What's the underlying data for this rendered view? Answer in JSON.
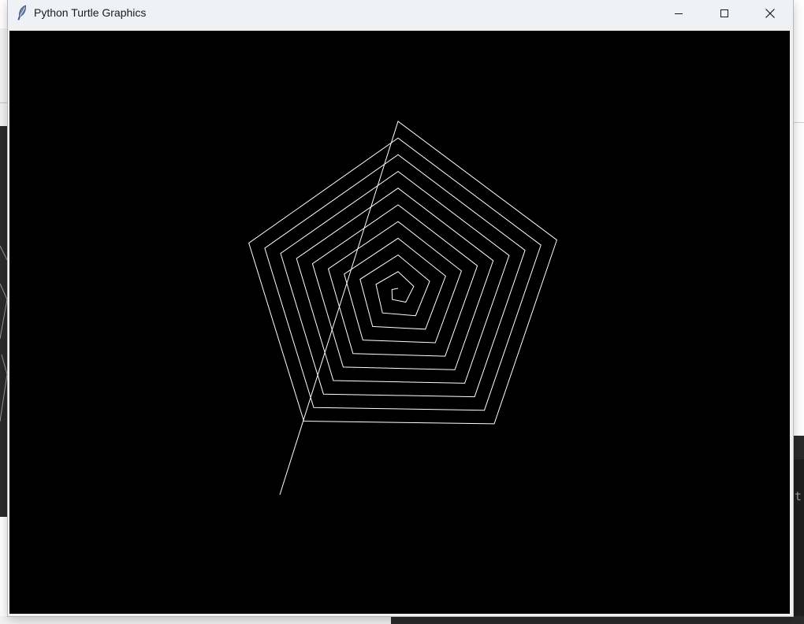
{
  "window": {
    "title": "Python Turtle Graphics",
    "app_icon": "feather-icon",
    "controls": [
      "minimize-icon",
      "maximize-icon",
      "close-icon"
    ]
  },
  "canvas": {
    "background": "#000000",
    "pen_color": "#ffffff",
    "drawing": "pentagon-spiral"
  },
  "background_app": {
    "right_glyph": "t"
  }
}
